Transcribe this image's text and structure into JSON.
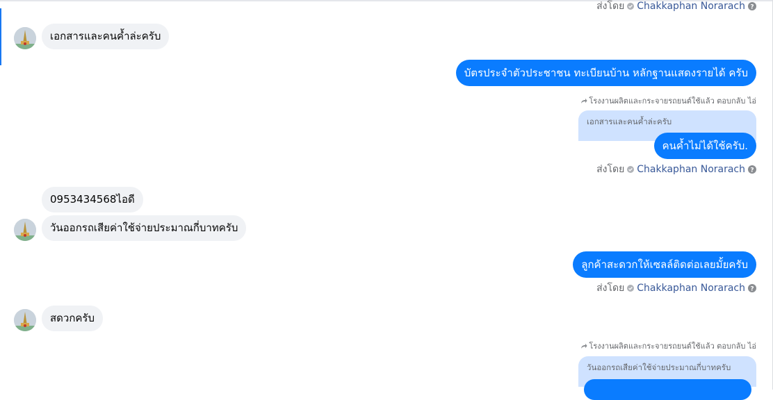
{
  "chat": {
    "sender_prefix": "ส่งโดย",
    "sender_name": "Chakkaphan Norarach",
    "messages": [
      {
        "dir": "in",
        "text": "เอกสารและคนค้ำล่ะครับ"
      },
      {
        "dir": "out",
        "text": "บัตรประจำตัวประชาชน ทะเบียนบ้าน หลักฐานแสดงรายได้ ครับ"
      },
      {
        "dir": "out",
        "reply_note": "โรงงานผลิตและกระจายรถยนต์ใช้แล้ว ตอบกลับ ไอ่",
        "quote": "เอกสารและคนค้ำล่ะครับ",
        "text": "คนค้ำไม่ได้ใช้ครับ."
      },
      {
        "dir": "in",
        "text": "0953434568ไอดี"
      },
      {
        "dir": "in",
        "text": "วันออกรถเสียค่าใช้จ่ายประมาณกี่บาทครับ"
      },
      {
        "dir": "out",
        "text": "ลูกค้าสะดวกให้เซลล์ติดต่อเลยมั้ยครับ"
      },
      {
        "dir": "in",
        "text": "สดวกครับ"
      },
      {
        "dir": "out",
        "reply_note": "โรงงานผลิตและกระจายรถยนต์ใช้แล้ว ตอบกลับ ไอ่",
        "quote": "วันออกรถเสียค่าใช้จ่ายประมาณกี่บาทครับ"
      }
    ]
  },
  "icons": {
    "verified": "verified-check-icon",
    "help": "question-circle-icon",
    "reply": "reply-arrow-icon",
    "avatar": "page-avatar"
  },
  "colors": {
    "outgoing_bubble": "#0a7cff",
    "incoming_bubble": "#f0f2f5",
    "quote_bubble": "#cfe2ff",
    "sender_name": "#385898",
    "muted_text": "#65676b"
  }
}
